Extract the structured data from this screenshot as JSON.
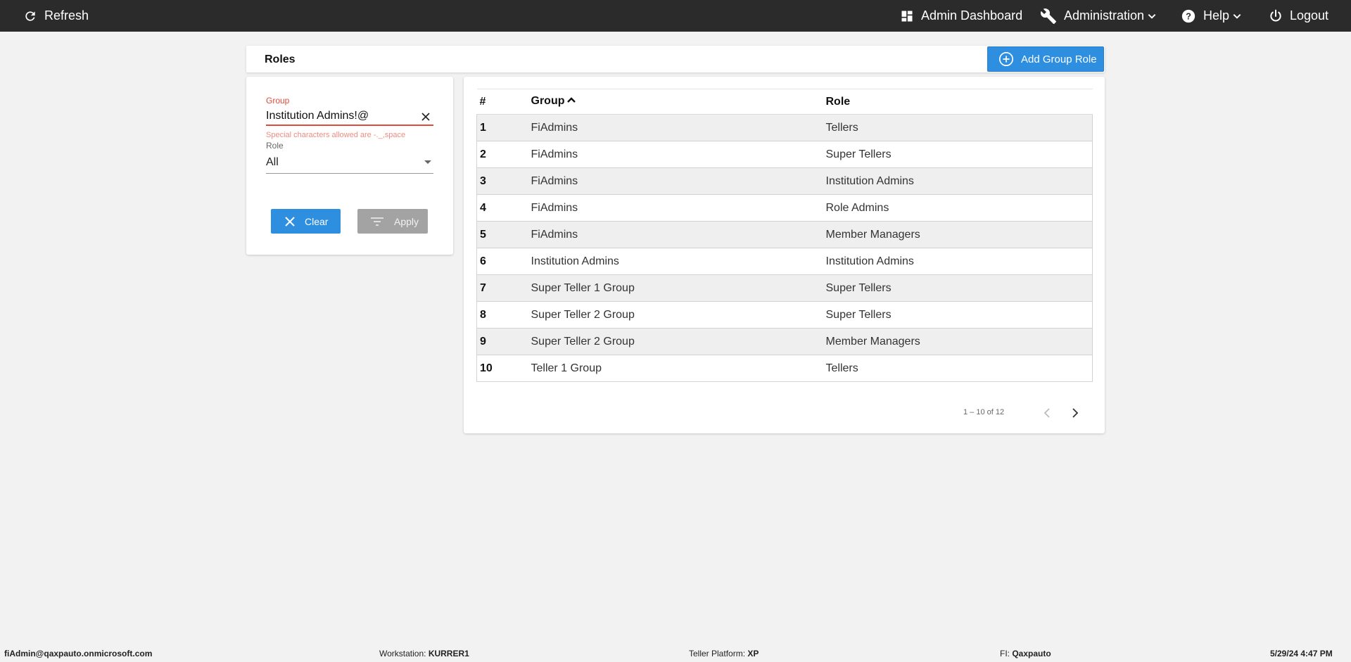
{
  "topbar": {
    "refresh_label": "Refresh",
    "admin_dashboard_label": "Admin Dashboard",
    "administration_label": "Administration",
    "help_label": "Help",
    "logout_label": "Logout"
  },
  "page": {
    "title": "Roles",
    "add_button_label": "Add Group Role"
  },
  "filter": {
    "group_label": "Group",
    "group_value": "Institution Admins!@",
    "group_hint": "Special characters allowed are -._,space",
    "role_label": "Role",
    "role_value": "All",
    "clear_label": "Clear",
    "apply_label": "Apply"
  },
  "table": {
    "headers": {
      "num": "#",
      "group": "Group",
      "role": "Role"
    },
    "sort": {
      "column": "Group",
      "direction": "ascending"
    },
    "rows": [
      {
        "num": "1",
        "group": "FiAdmins",
        "role": "Tellers"
      },
      {
        "num": "2",
        "group": "FiAdmins",
        "role": "Super Tellers"
      },
      {
        "num": "3",
        "group": "FiAdmins",
        "role": "Institution Admins"
      },
      {
        "num": "4",
        "group": "FiAdmins",
        "role": "Role Admins"
      },
      {
        "num": "5",
        "group": "FiAdmins",
        "role": "Member Managers"
      },
      {
        "num": "6",
        "group": "Institution Admins",
        "role": "Institution Admins"
      },
      {
        "num": "7",
        "group": "Super Teller 1 Group",
        "role": "Super Tellers"
      },
      {
        "num": "8",
        "group": "Super Teller 2 Group",
        "role": "Super Tellers"
      },
      {
        "num": "9",
        "group": "Super Teller 2 Group",
        "role": "Member Managers"
      },
      {
        "num": "10",
        "group": "Teller 1 Group",
        "role": "Tellers"
      }
    ],
    "pager_text": "1 – 10 of 12"
  },
  "statusbar": {
    "user": "fiAdmin@qaxpauto.onmicrosoft.com",
    "workstation_label": "Workstation:",
    "workstation_value": "KURRER1",
    "platform_label": "Teller Platform:",
    "platform_value": "XP",
    "fi_label": "FI:",
    "fi_value": "Qaxpauto",
    "datetime": "5/29/24 4:47 PM"
  },
  "colors": {
    "topbar_bg": "#2b2b2b",
    "accent_blue": "#2e8ee0",
    "error_red": "#e04b3a",
    "disabled_gray": "#a3a3a3"
  },
  "icons": [
    "refresh-icon",
    "dashboard-icon",
    "wrench-icon",
    "chevron-down-icon",
    "help-icon",
    "power-icon",
    "add-circle-icon",
    "close-icon",
    "filter-icon",
    "chevron-left-icon",
    "chevron-right-icon",
    "sort-up-icon",
    "dropdown-caret-icon"
  ]
}
